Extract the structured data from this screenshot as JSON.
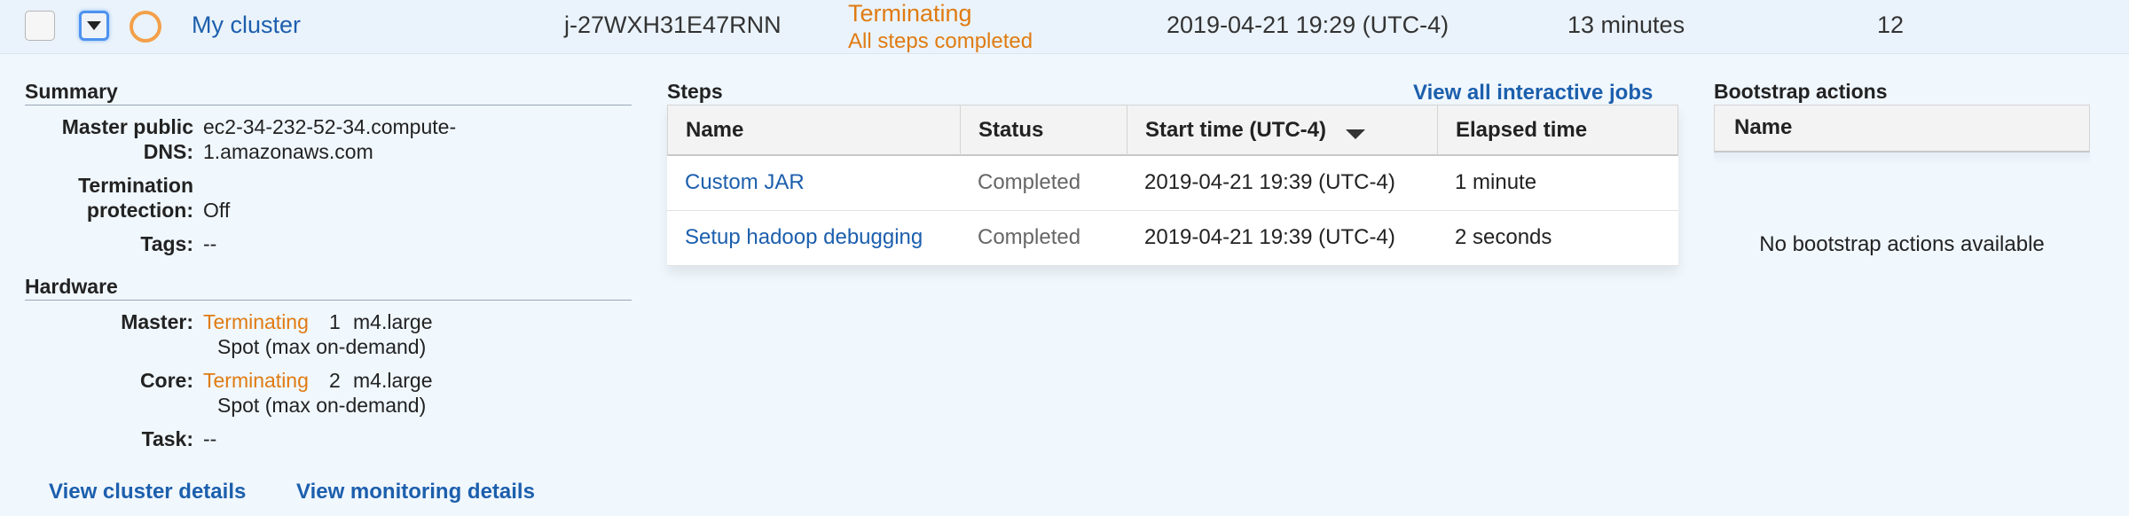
{
  "row": {
    "cluster_name": "My cluster",
    "cluster_id": "j-27WXH31E47RNN",
    "status": "Terminating",
    "status_detail": "All steps completed",
    "creation_time": "2019-04-21 19:29 (UTC-4)",
    "elapsed": "13 minutes",
    "normalized_hours": "12"
  },
  "summary": {
    "title": "Summary",
    "dns_label_1": "Master public",
    "dns_label_2": "DNS:",
    "dns_value_1": "ec2-34-232-52-34.compute-",
    "dns_value_2": "1.amazonaws.com",
    "term_label_1": "Termination",
    "term_label_2": "protection:",
    "term_value": "Off",
    "tags_label": "Tags:",
    "tags_value": "--"
  },
  "hardware": {
    "title": "Hardware",
    "master_label": "Master:",
    "master_status": "Terminating",
    "master_count": "1",
    "master_type": "m4.large",
    "master_purchase": "Spot (max on-demand)",
    "core_label": "Core:",
    "core_status": "Terminating",
    "core_count": "2",
    "core_type": "m4.large",
    "core_purchase": "Spot (max on-demand)",
    "task_label": "Task:",
    "task_value": "--"
  },
  "links": {
    "cluster_details": "View cluster details",
    "monitoring_details": "View monitoring details",
    "interactive_jobs": "View all interactive jobs"
  },
  "steps": {
    "title": "Steps",
    "columns": [
      "Name",
      "Status",
      "Start time (UTC-4)",
      "Elapsed time"
    ],
    "rows": [
      {
        "name": "Custom JAR",
        "status": "Completed",
        "start": "2019-04-21 19:39 (UTC-4)",
        "elapsed": "1 minute"
      },
      {
        "name": "Setup hadoop debugging",
        "status": "Completed",
        "start": "2019-04-21 19:39 (UTC-4)",
        "elapsed": "2 seconds"
      }
    ]
  },
  "bootstrap": {
    "title": "Bootstrap actions",
    "column": "Name",
    "empty": "No bootstrap actions available"
  },
  "colors": {
    "link": "#1c5fad",
    "warning": "#e07b12",
    "background": "#f0f7fd"
  },
  "icons": [
    "select-checkbox",
    "collapse-arrow-icon",
    "status-ring-icon",
    "sort-desc-icon"
  ]
}
